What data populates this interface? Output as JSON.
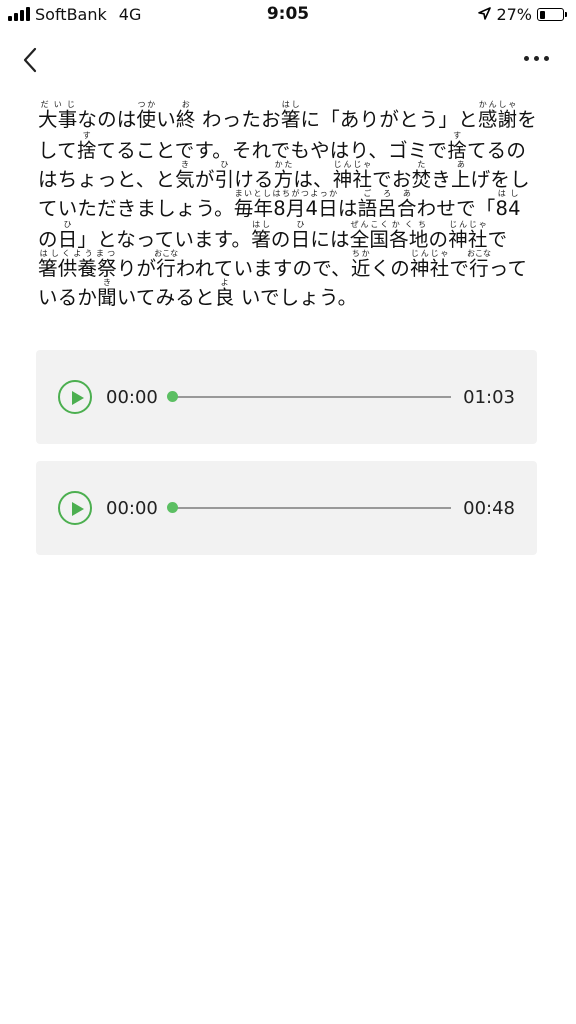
{
  "status_bar": {
    "carrier": "SoftBank",
    "network": "4G",
    "time": "9:05",
    "battery_percent": "27%",
    "battery_level": 0.27,
    "location_icon": "location-arrow-icon",
    "signal_icon": "cellular-signal-icon",
    "battery_icon": "battery-icon"
  },
  "nav": {
    "back_icon": "chevron-left-icon",
    "more_icon": "more-horizontal-icon"
  },
  "article": {
    "segments": [
      {
        "t": "大事",
        "r": "だいじ"
      },
      {
        "t": "なのは"
      },
      {
        "t": "使",
        "r": "つか"
      },
      {
        "t": "い"
      },
      {
        "t": "終",
        "r": "お"
      },
      {
        "t": " わったお"
      },
      {
        "t": "箸",
        "r": "はし"
      },
      {
        "t": "に「ありがとう」と"
      },
      {
        "t": "感謝",
        "r": "かんしゃ"
      },
      {
        "t": "をして"
      },
      {
        "t": "捨",
        "r": "す"
      },
      {
        "t": "てることです。それでもやはり、ゴミで"
      },
      {
        "t": "捨",
        "r": "す"
      },
      {
        "t": "てるのはちょっと、と"
      },
      {
        "t": "気",
        "r": "き"
      },
      {
        "t": "が"
      },
      {
        "t": "引",
        "r": "ひ"
      },
      {
        "t": "ける"
      },
      {
        "t": "方",
        "r": "かた"
      },
      {
        "t": "は、"
      },
      {
        "t": "神社",
        "r": "じんじゃ"
      },
      {
        "t": "でお"
      },
      {
        "t": "焚",
        "r": "た"
      },
      {
        "t": "き"
      },
      {
        "t": "上",
        "r": "あ"
      },
      {
        "t": "げをしていただきましょう。"
      },
      {
        "t": "毎年8月4日",
        "r": "まいとしはちがつよっか"
      },
      {
        "t": "は"
      },
      {
        "t": "語呂",
        "r": "ごろ"
      },
      {
        "t": "合",
        "r": "あ"
      },
      {
        "t": "わせで「"
      },
      {
        "t": "84",
        "r": "はし"
      },
      {
        "t": "の"
      },
      {
        "t": "日",
        "r": "ひ"
      },
      {
        "t": "」となっています。"
      },
      {
        "t": "箸",
        "r": "はし"
      },
      {
        "t": "の"
      },
      {
        "t": "日",
        "r": "ひ"
      },
      {
        "t": "には"
      },
      {
        "t": "全国",
        "r": "ぜんこく"
      },
      {
        "t": "各地",
        "r": "かくち"
      },
      {
        "t": "の"
      },
      {
        "t": "神社",
        "r": "じんじゃ"
      },
      {
        "t": "で"
      },
      {
        "t": "箸供養祭",
        "r": "はしくようまつ"
      },
      {
        "t": "りが"
      },
      {
        "t": "行",
        "r": "おこな"
      },
      {
        "t": "われていますので、"
      },
      {
        "t": "近",
        "r": "ちか"
      },
      {
        "t": "く"
      },
      {
        "t": "の"
      },
      {
        "t": "神社",
        "r": "じんじゃ"
      },
      {
        "t": "で"
      },
      {
        "t": "行",
        "r": "おこな"
      },
      {
        "t": "っているか"
      },
      {
        "t": "聞",
        "r": "き"
      },
      {
        "t": "いてみると"
      },
      {
        "t": "良",
        "r": "よ"
      },
      {
        "t": " いでしょう。"
      }
    ]
  },
  "players": [
    {
      "current": "00:00",
      "duration": "01:03",
      "progress": 0,
      "play_icon": "play-icon"
    },
    {
      "current": "00:00",
      "duration": "00:48",
      "progress": 0,
      "play_icon": "play-icon"
    }
  ],
  "colors": {
    "accent": "#4caf50",
    "player_bg": "#f2f2f2",
    "track": "#999999",
    "text": "#111111"
  }
}
